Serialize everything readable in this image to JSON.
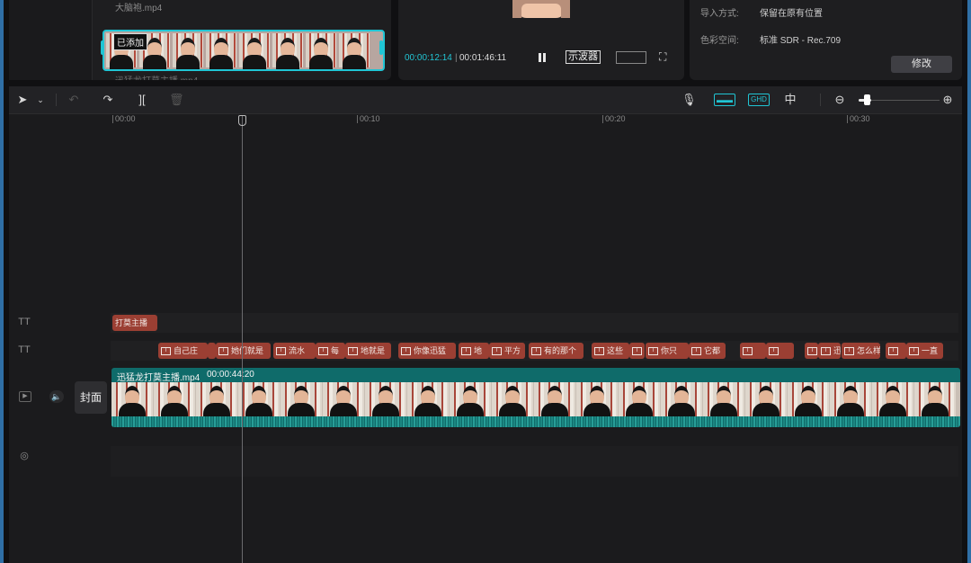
{
  "media": {
    "file_top": "大脑袍.mp4",
    "file_bottom": "迅猛龙打莫主播.mp4",
    "added_badge": "已添加"
  },
  "player": {
    "current_time": "00:00:12:14",
    "separator": "|",
    "total_time": "00:01:46:11",
    "scope_label": "示波器"
  },
  "properties": {
    "import_key": "导入方式:",
    "import_value": "保留在原有位置",
    "color_key": "色彩空间:",
    "color_value": "标准 SDR - Rec.709",
    "modify_label": "修改"
  },
  "ruler": {
    "ticks": [
      "00:00",
      "00:10",
      "00:20",
      "00:30"
    ]
  },
  "tracks": {
    "title_clip": "打莫主播",
    "subtitles": [
      "自己庄",
      "",
      "她们就是",
      "流水",
      "每",
      "地就是",
      "你像迅猛",
      "地",
      "平方",
      "有的那个",
      "这些",
      "",
      "你只",
      "它都",
      "",
      "",
      "",
      "迅猛",
      "怎么样",
      "",
      "一直"
    ],
    "cover_label": "封面",
    "video_clip_name": "迅猛龙打莫主播.mp4",
    "video_clip_duration": "00:00:44:20"
  },
  "colors": {
    "accent": "#20c5d4",
    "subtitle_chip": "#9b3f33",
    "video_clip": "#0f6b6a"
  }
}
